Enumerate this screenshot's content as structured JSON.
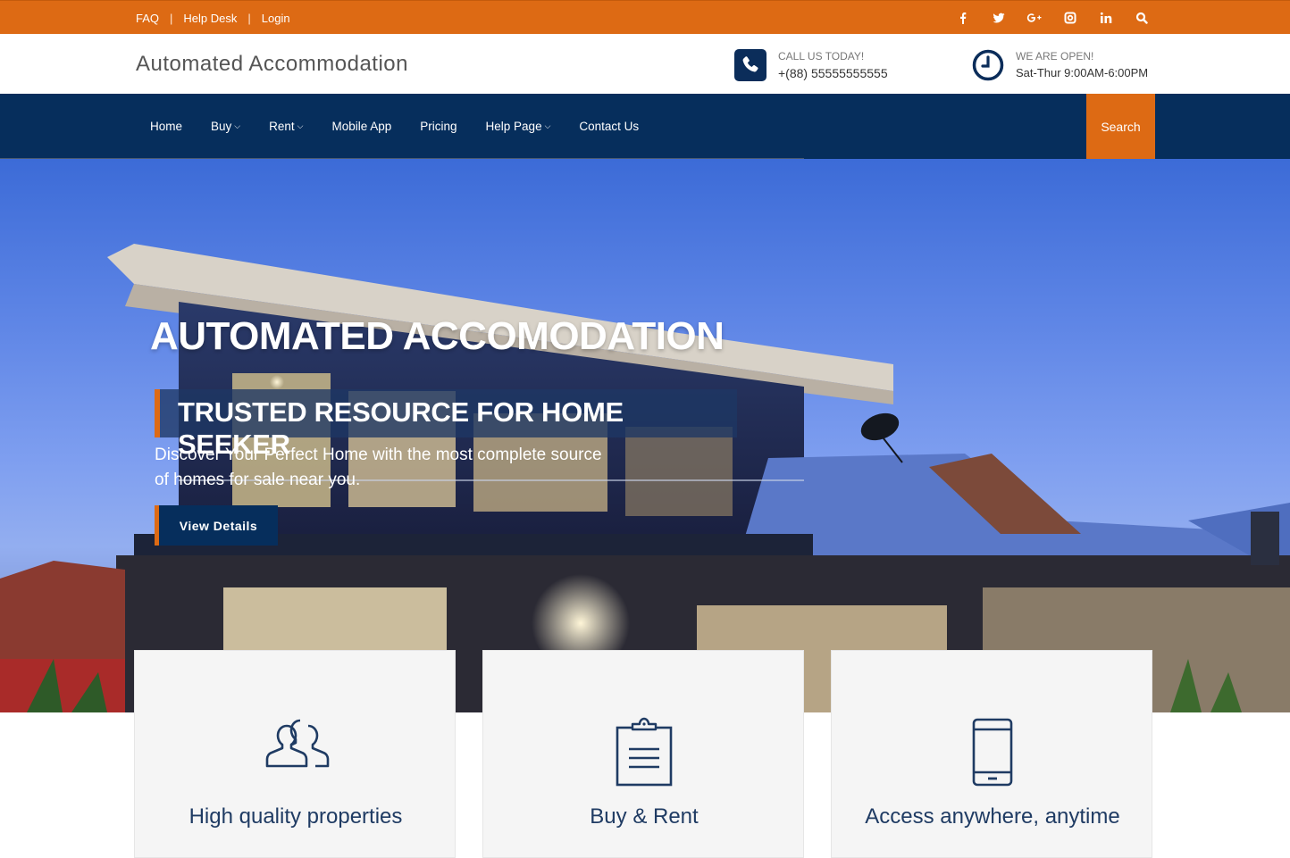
{
  "topbar": {
    "links": [
      "FAQ",
      "Help Desk",
      "Login"
    ],
    "social_icons": [
      "facebook-icon",
      "twitter-icon",
      "google-plus-icon",
      "instagram-icon",
      "linkedin-icon",
      "search-icon"
    ]
  },
  "header": {
    "brand": "Automated Accommodation",
    "call_label": "CALL US TODAY!",
    "call_phone": "+(88) 55555555555",
    "open_label": "WE ARE OPEN!",
    "open_hours": "Sat-Thur 9:00AM-6:00PM"
  },
  "nav": {
    "items": [
      {
        "label": "Home",
        "dropdown": false
      },
      {
        "label": "Buy",
        "dropdown": true
      },
      {
        "label": "Rent",
        "dropdown": true
      },
      {
        "label": "Mobile App",
        "dropdown": false
      },
      {
        "label": "Pricing",
        "dropdown": false
      },
      {
        "label": "Help Page",
        "dropdown": true
      },
      {
        "label": "Contact Us",
        "dropdown": false
      }
    ],
    "search_label": "Search"
  },
  "hero": {
    "title": "AUTOMATED ACCOMODATION",
    "subtitle": "TRUSTED RESOURCE FOR HOME SEEKER",
    "description": "Discover Your Perfect Home with the most complete source of homes for sale near you.",
    "button_label": "View Details"
  },
  "features": [
    {
      "icon": "users-icon",
      "label": "High quality properties"
    },
    {
      "icon": "clipboard-icon",
      "label": "Buy & Rent"
    },
    {
      "icon": "mobile-icon",
      "label": "Access anywhere, anytime"
    }
  ],
  "colors": {
    "accent": "#dd6a14",
    "navy": "#062e5c"
  }
}
